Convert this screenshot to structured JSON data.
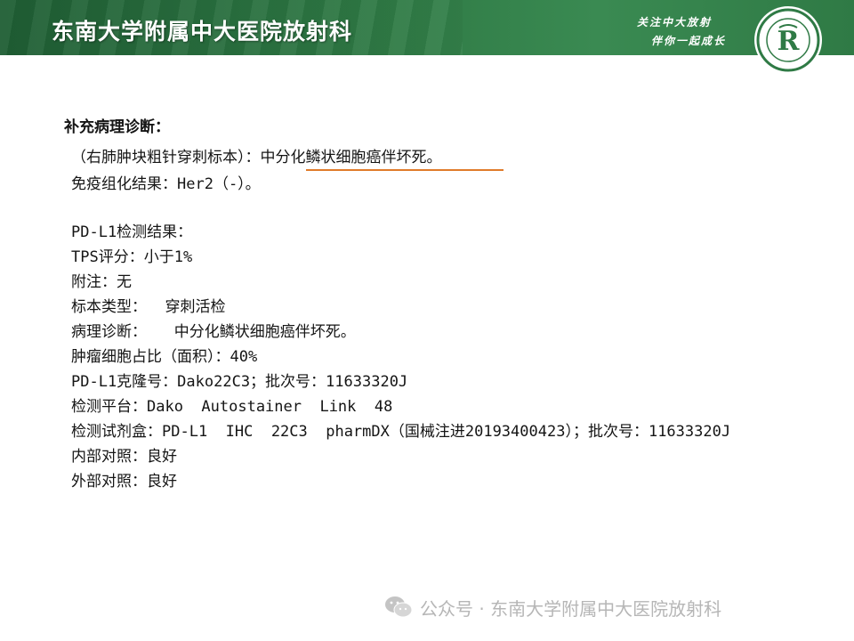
{
  "header": {
    "title": "东南大学附属中大医院放射科",
    "slogan_line1": "关注中大放射",
    "slogan_line2": "伴你一起成长",
    "logo_letter": "R"
  },
  "report": {
    "heading": "补充病理诊断：",
    "line1_prefix": "（右肺肿块粗针穿刺标本）：",
    "line1_highlight": "中分化鳞状细胞癌伴坏死。",
    "line2": "免疫组化结果：Her2（-）。",
    "pdl1_heading": "PD-L1检测结果：",
    "tps": "TPS评分：小于1%",
    "note": "附注：无",
    "sample_type": "标本类型：  穿刺活检",
    "diagnosis": "病理诊断：   中分化鳞状细胞癌伴坏死。",
    "tumor_ratio": "肿瘤细胞占比（面积）：40%",
    "clone": "PD-L1克隆号：Dako22C3；批次号：11633320J",
    "platform": "检测平台：Dako  Autostainer  Link  48",
    "kit": "检测试剂盒：PD-L1  IHC  22C3  pharmDX（国械注进20193400423）；批次号：11633320J",
    "internal_control": "内部对照：良好",
    "external_control": "外部对照：良好"
  },
  "watermark": {
    "text": "公众号 · 东南大学附属中大医院放射科"
  },
  "colors": {
    "banner_green": "#2f7a45",
    "underline_orange": "#e07b2a"
  }
}
